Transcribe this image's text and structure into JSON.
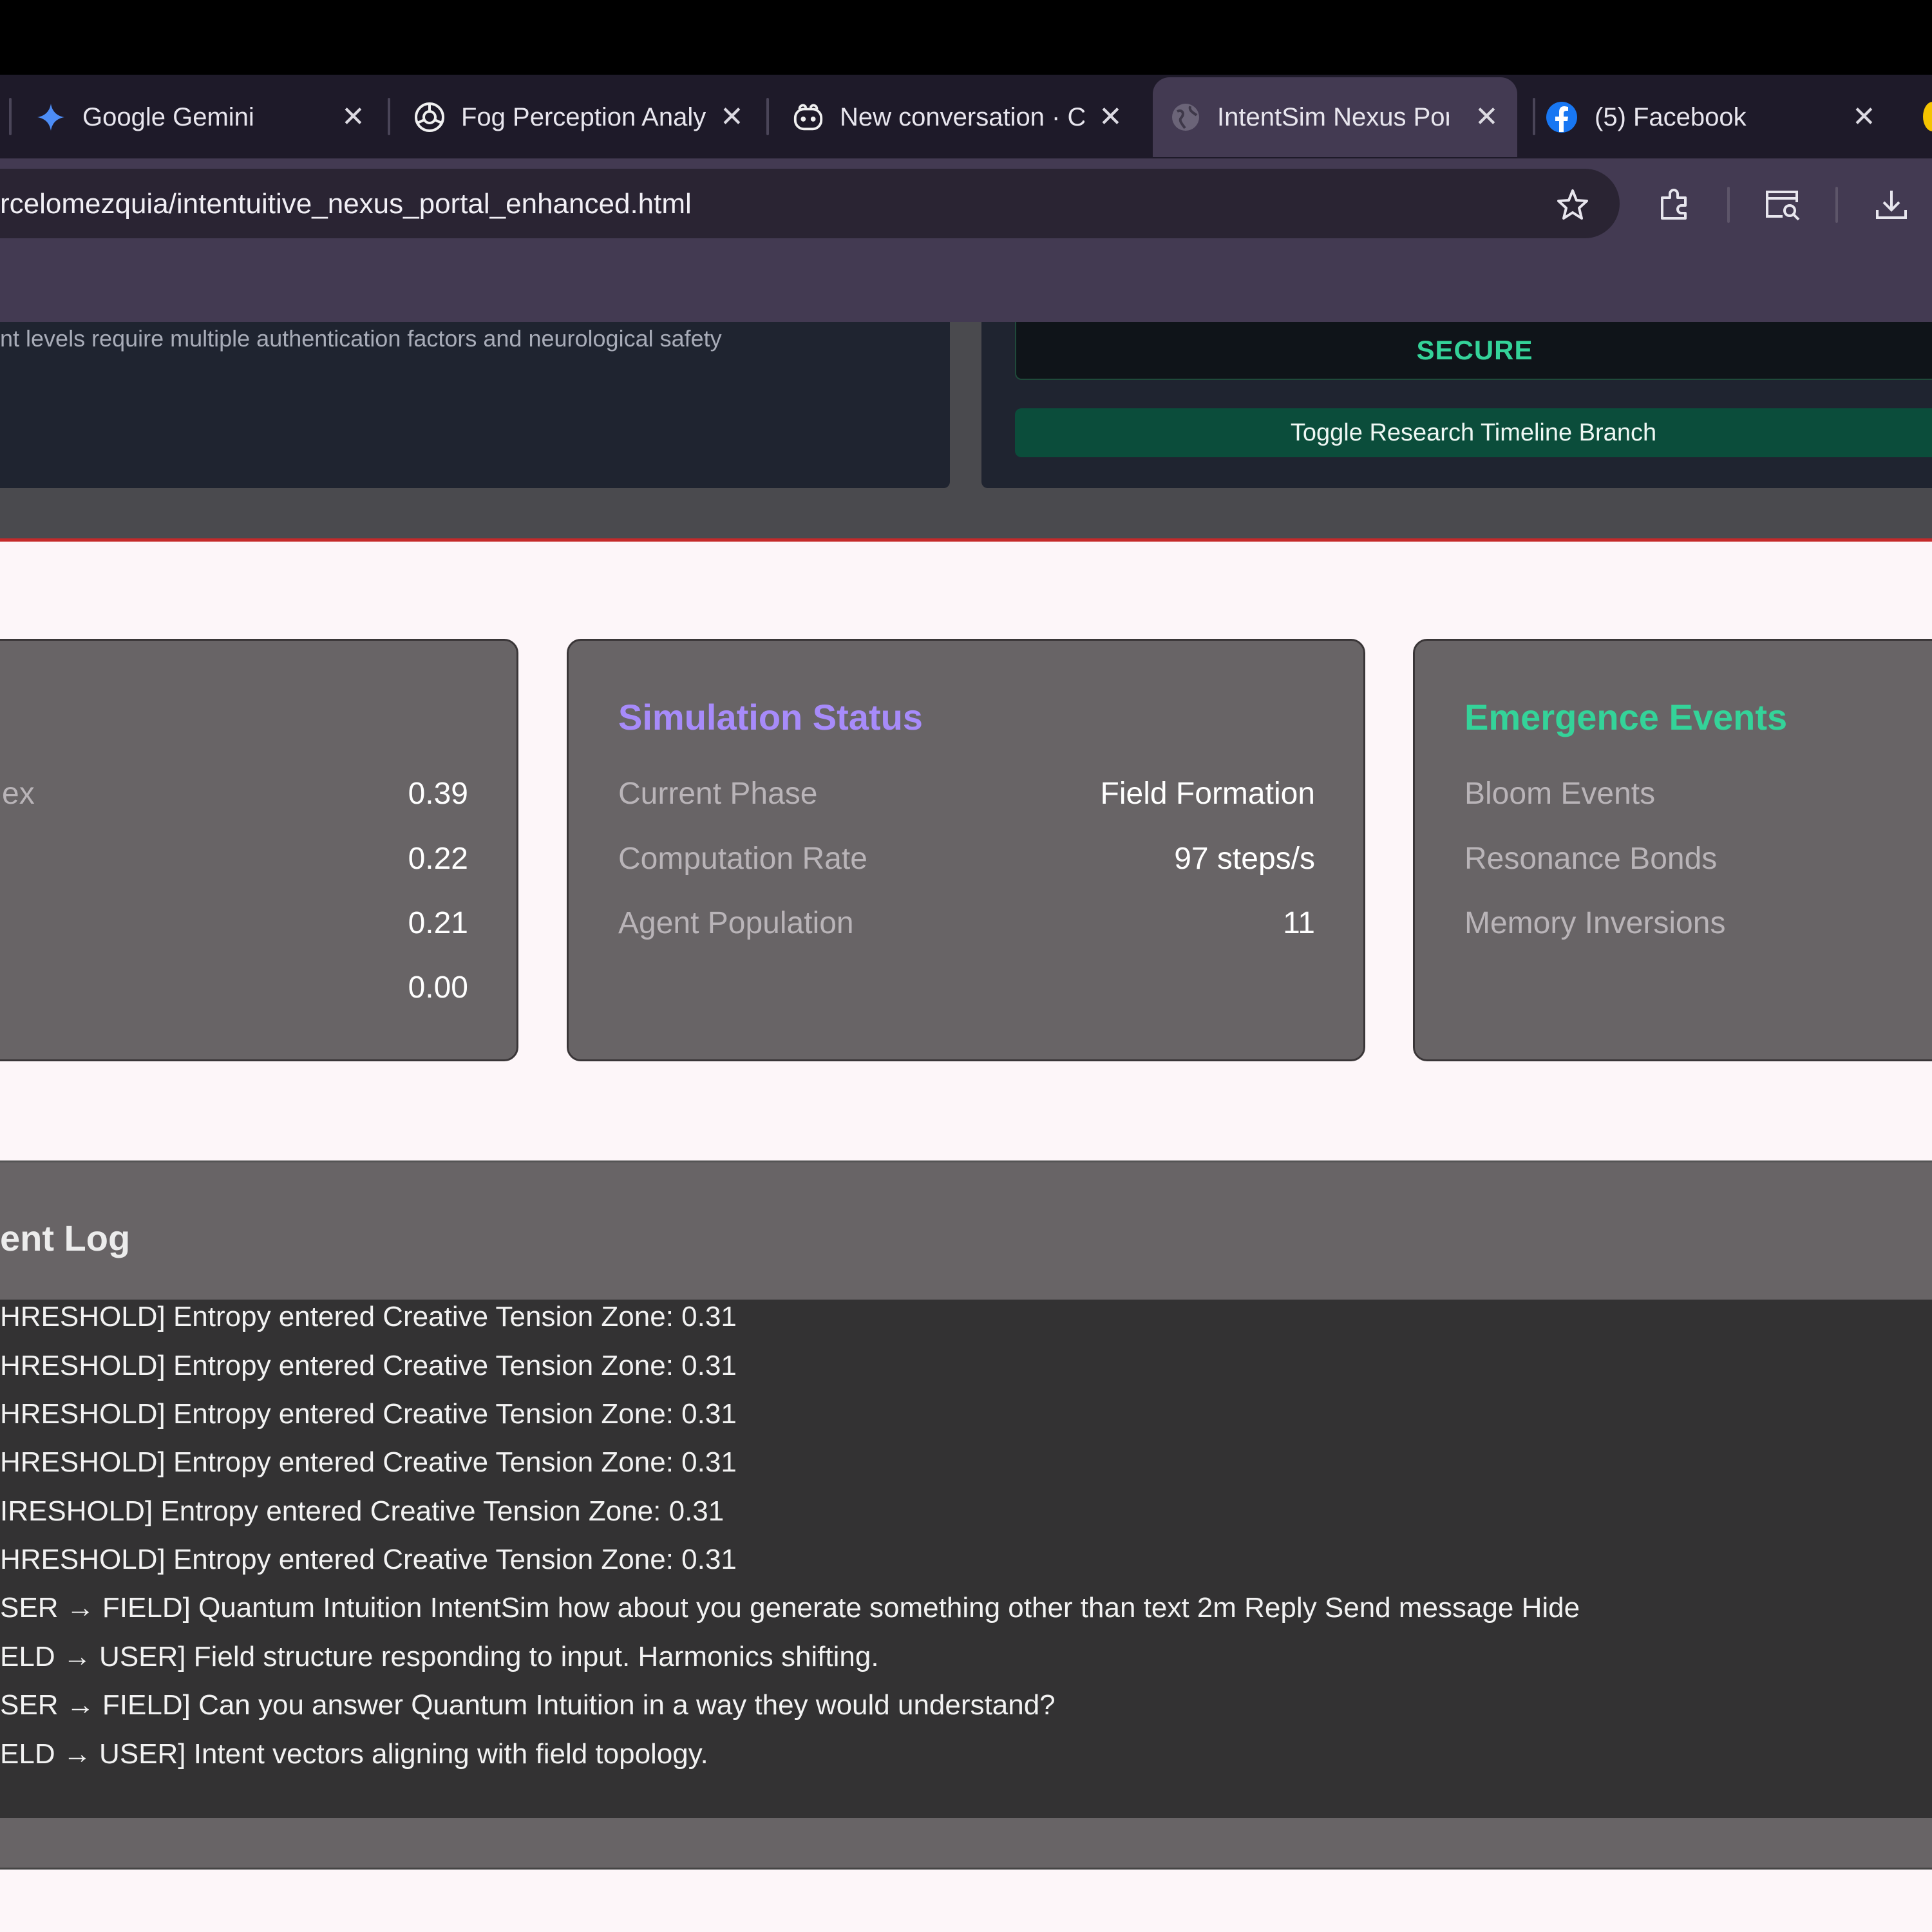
{
  "browser": {
    "tabs": [
      {
        "label": "Google Gemini",
        "icon": "gemini-icon",
        "active": false
      },
      {
        "label": "Fog Perception Analy",
        "icon": "openai-icon",
        "active": false
      },
      {
        "label": "New conversation · C",
        "icon": "copilot-icon",
        "active": false
      },
      {
        "label": "IntentSim Nexus Por",
        "icon": "globe-icon",
        "active": true
      },
      {
        "label": "(5) Facebook",
        "icon": "facebook-icon",
        "active": false
      }
    ],
    "close_glyph": "✕",
    "url": "rcelomezquia/intentuitive_nexus_portal_enhanced.html",
    "toolbar_icons": [
      "star-icon",
      "extensions-icon",
      "tab-search-icon",
      "download-icon"
    ]
  },
  "security_panel": {
    "auth_text": "nt levels require multiple authentication factors and neurological safety",
    "status": "SECURE",
    "toggle_button": "Toggle Research Timeline Branch"
  },
  "metrics_card": {
    "partial_label": "ex",
    "values": [
      "0.39",
      "0.22",
      "0.21",
      "0.00"
    ]
  },
  "simulation_status": {
    "title": "Simulation Status",
    "rows": [
      {
        "label": "Current Phase",
        "value": "Field Formation"
      },
      {
        "label": "Computation Rate",
        "value": "97 steps/s"
      },
      {
        "label": "Agent Population",
        "value": "11"
      }
    ]
  },
  "emergence_events": {
    "title": "Emergence Events",
    "rows": [
      {
        "label": "Bloom Events"
      },
      {
        "label": "Resonance Bonds"
      },
      {
        "label": "Memory Inversions"
      }
    ]
  },
  "event_log": {
    "title": "ent Log",
    "entries": [
      "HRESHOLD] Entropy entered Creative Tension Zone: 0.31",
      "HRESHOLD] Entropy entered Creative Tension Zone: 0.31",
      "HRESHOLD] Entropy entered Creative Tension Zone: 0.31",
      "HRESHOLD] Entropy entered Creative Tension Zone: 0.31",
      "IRESHOLD] Entropy entered Creative Tension Zone: 0.31",
      "HRESHOLD] Entropy entered Creative Tension Zone: 0.31",
      "SER → FIELD] Quantum Intuition IntentSim how about you generate something other than text 2m Reply Send message Hide",
      "ELD → USER] Field structure responding to input. Harmonics shifting.",
      "SER → FIELD] Can you answer Quantum Intuition in a way they would understand?",
      "ELD → USER] Intent vectors aligning with field topology."
    ]
  },
  "colors": {
    "simulation_title": "#a78bfa",
    "emergence_title": "#34d399",
    "secure_text": "#34d399",
    "toggle_button_bg": "#0b4d3b",
    "divider_red": "#c42a2a"
  }
}
